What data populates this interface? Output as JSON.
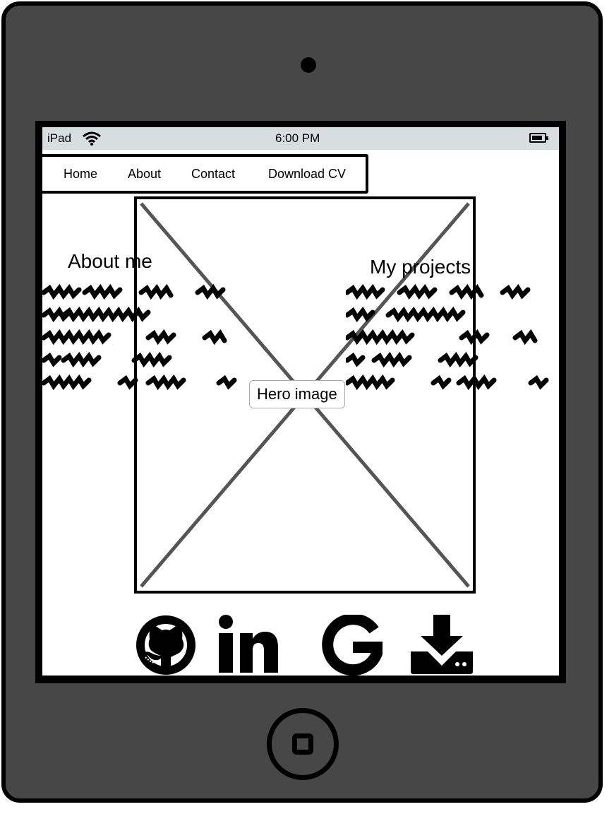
{
  "status_bar": {
    "carrier": "iPad",
    "time": "6:00 PM"
  },
  "nav": {
    "items": [
      "Home",
      "About",
      "Contact",
      "Download CV"
    ]
  },
  "hero": {
    "label": "Hero image"
  },
  "about": {
    "heading": "About me"
  },
  "projects": {
    "heading": "My projects"
  },
  "icons": [
    "github-icon",
    "linkedin-icon",
    "google-icon",
    "download-icon"
  ]
}
